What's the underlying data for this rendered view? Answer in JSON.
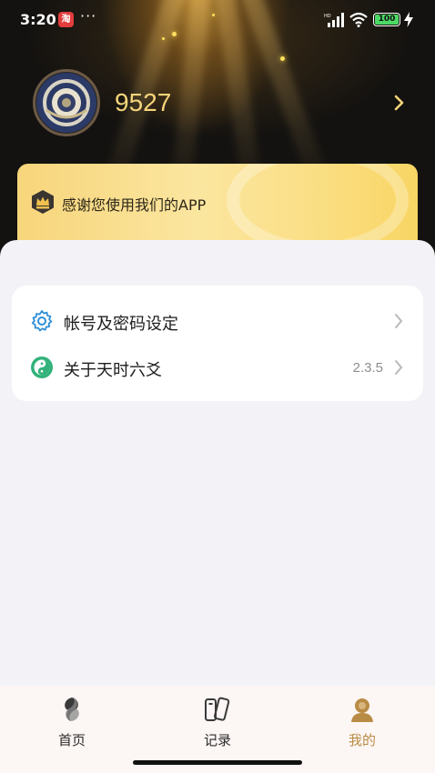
{
  "status_bar": {
    "time": "3:20",
    "notification_badge": "淘",
    "more": "···",
    "battery": "100"
  },
  "profile": {
    "username": "9527"
  },
  "banner": {
    "text": "感谢您使用我们的APP"
  },
  "menu": {
    "items": [
      {
        "label": "帐号及密码设定",
        "value": "",
        "icon": "gear-icon"
      },
      {
        "label": "关于天时六爻",
        "value": "2.3.5",
        "icon": "yinyang-icon"
      }
    ]
  },
  "tabbar": {
    "active_color": "#b98c45",
    "tabs": [
      {
        "label": "首页",
        "icon": "home-fish-icon"
      },
      {
        "label": "记录",
        "icon": "record-book-icon"
      },
      {
        "label": "我的",
        "icon": "profile-person-icon"
      }
    ]
  }
}
